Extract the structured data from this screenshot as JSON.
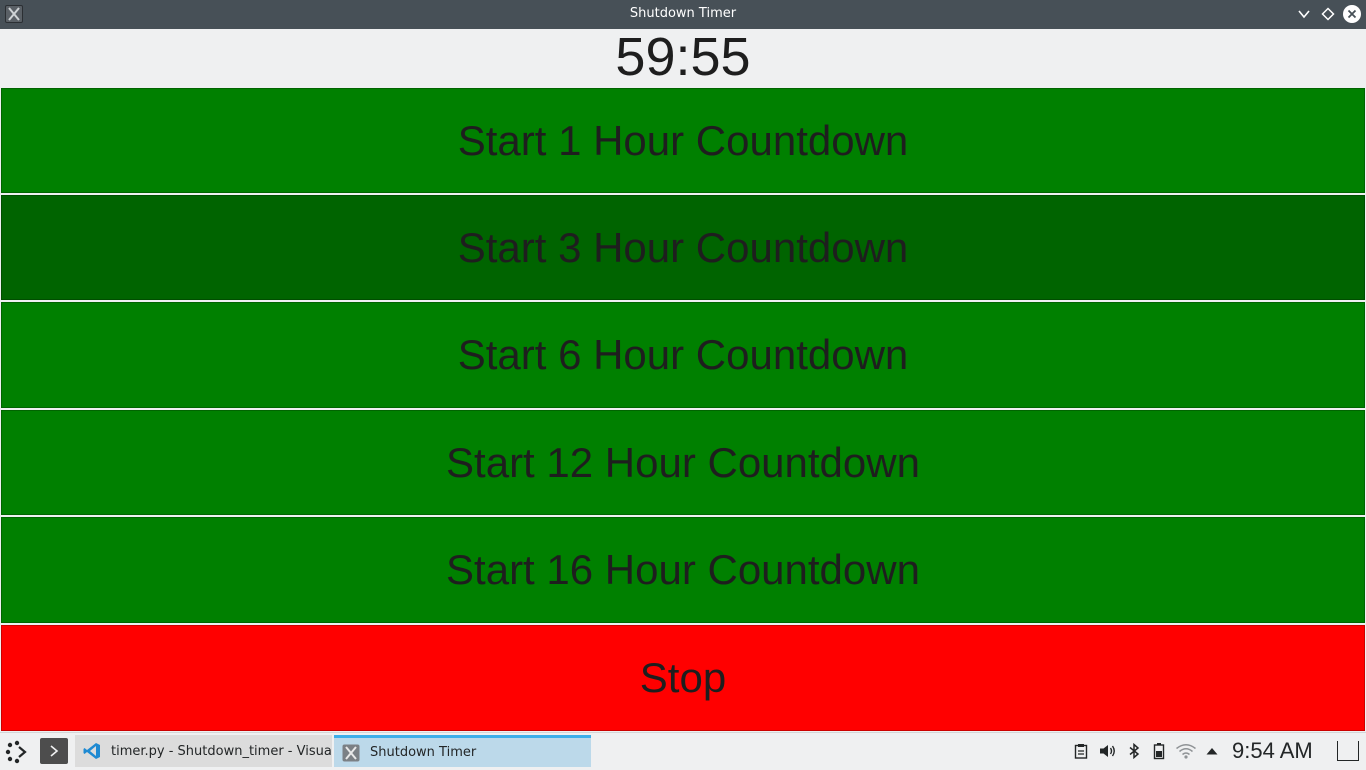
{
  "window": {
    "title": "Shutdown Timer"
  },
  "timer": {
    "display": "59:55"
  },
  "buttons": [
    {
      "label": "Start 1 Hour Countdown",
      "color": "#008000"
    },
    {
      "label": "Start 3 Hour Countdown",
      "color": "#006400"
    },
    {
      "label": "Start 6 Hour Countdown",
      "color": "#008000"
    },
    {
      "label": "Start 12 Hour Countdown",
      "color": "#008000"
    },
    {
      "label": "Start 16 Hour Countdown",
      "color": "#008000"
    },
    {
      "label": "Stop",
      "color": "#ff0000"
    }
  ],
  "taskbar": {
    "tasks": [
      {
        "label": "timer.py - Shutdown_timer - Visual...",
        "icon": "vscode-icon"
      },
      {
        "label": "Shutdown Timer",
        "icon": "x-app-icon",
        "active": true
      }
    ],
    "tray_icons": [
      "clipboard-icon",
      "volume-icon",
      "bluetooth-icon",
      "battery-icon",
      "wifi-icon",
      "expand-tray-icon"
    ],
    "clock": "9:54 AM"
  }
}
